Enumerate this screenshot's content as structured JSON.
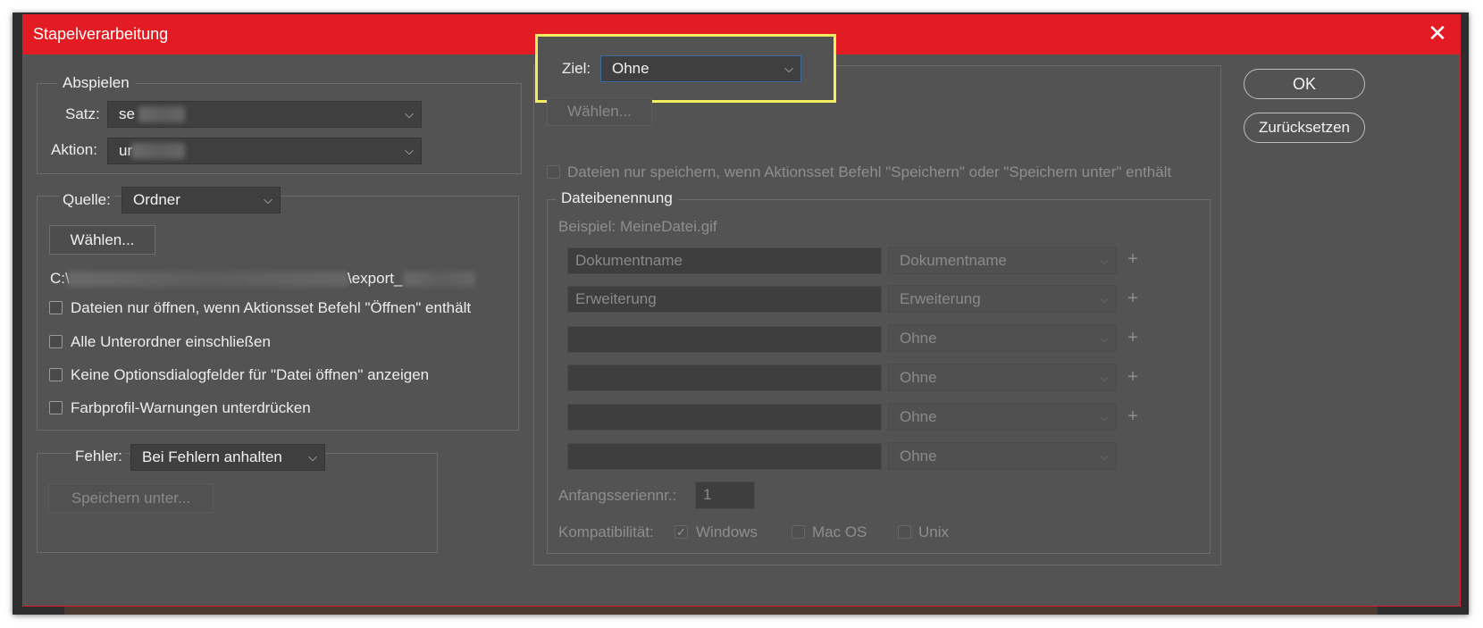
{
  "dialog": {
    "title": "Stapelverarbeitung"
  },
  "abspielen": {
    "legend": "Abspielen",
    "satz_label": "Satz:",
    "satz_value": "se",
    "aktion_label": "Aktion:",
    "aktion_value": "ur"
  },
  "quelle": {
    "label": "Quelle:",
    "value": "Ordner",
    "choose_button": "Wählen...",
    "path_prefix": "C:\\",
    "path_suffix": "\\export_",
    "options": [
      "Dateien nur öffnen, wenn Aktionsset Befehl \"Öffnen\" enthält",
      "Alle Unterordner einschließen",
      "Keine Optionsdialogfelder für \"Datei öffnen\" anzeigen",
      "Farbprofil-Warnungen unterdrücken"
    ]
  },
  "fehler": {
    "label": "Fehler:",
    "value": "Bei Fehlern anhalten",
    "save_button": "Speichern unter..."
  },
  "ziel": {
    "label": "Ziel:",
    "value": "Ohne",
    "choose_button": "Wählen...",
    "save_only_option": "Dateien nur speichern, wenn Aktionsset Befehl \"Speichern\" oder \"Speichern unter\" enthält"
  },
  "dateibenennung": {
    "legend": "Dateibenennung",
    "example": "Beispiel: MeineDatei.gif",
    "rows": [
      {
        "field": "Dokumentname",
        "select": "Dokumentname"
      },
      {
        "field": "Erweiterung",
        "select": "Erweiterung"
      },
      {
        "field": "",
        "select": "Ohne"
      },
      {
        "field": "",
        "select": "Ohne"
      },
      {
        "field": "",
        "select": "Ohne"
      },
      {
        "field": "",
        "select": "Ohne"
      }
    ],
    "plus": "+",
    "serial_label": "Anfangsseriennr.:",
    "serial_value": "1",
    "compat_label": "Kompatibilität:",
    "compat_windows": "Windows",
    "compat_macos": "Mac OS",
    "compat_unix": "Unix"
  },
  "buttons": {
    "ok": "OK",
    "reset": "Zurücksetzen"
  },
  "icons": {
    "close": "close-icon",
    "chevron": "chevron-down-icon",
    "check": "checkmark-icon"
  },
  "colors": {
    "titlebar": "#e31b23",
    "dialog_bg": "#535353",
    "highlight": "#f4ee5e"
  }
}
